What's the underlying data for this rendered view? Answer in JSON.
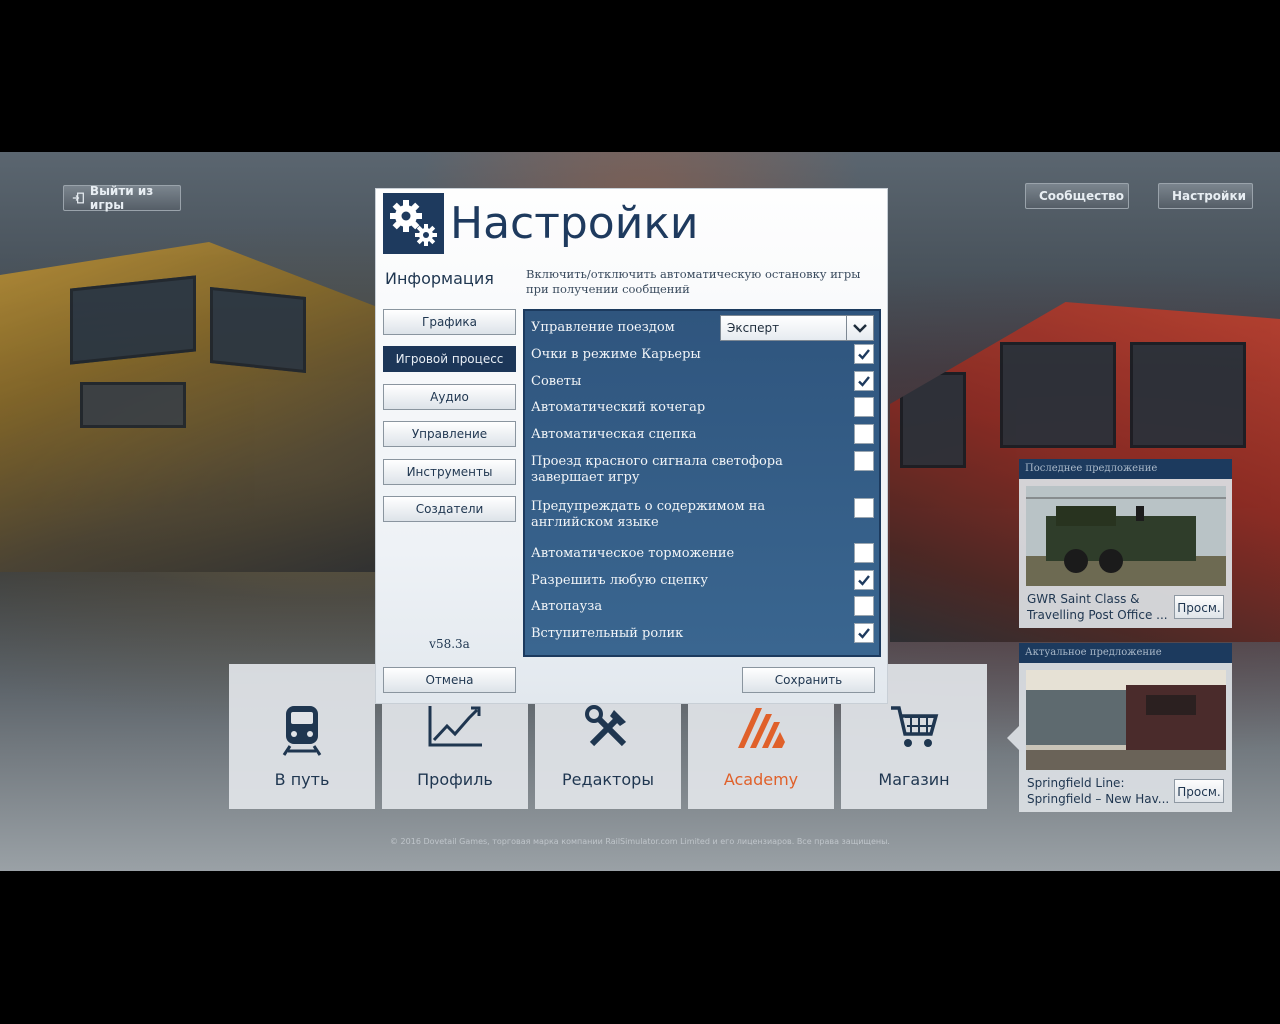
{
  "top_bar": {
    "exit_label": "Выйти из игры",
    "community_label": "Сообщество",
    "settings_label": "Настройки"
  },
  "dialog": {
    "title": "Настройки",
    "section": "Информация",
    "description": "Включить/отключить автоматическую остановку игры при получении сообщений",
    "nav": [
      "Графика",
      "Игровой процесс",
      "Аудио",
      "Управление",
      "Инструменты",
      "Создатели"
    ],
    "active_nav": "Игровой процесс",
    "version": "v58.3a",
    "train_control": {
      "label": "Управление поездом",
      "value": "Эксперт"
    },
    "options": [
      {
        "label": "Очки в режиме Карьеры",
        "checked": true
      },
      {
        "label": "Советы",
        "checked": true
      },
      {
        "label": "Автоматический кочегар",
        "checked": false
      },
      {
        "label": "Автоматическая сцепка",
        "checked": false
      },
      {
        "label": "Проезд красного сигнала светофора завершает игру",
        "checked": false
      },
      {
        "label": "Предупреждать о содержимом на английском языке",
        "checked": false
      },
      {
        "label": "Автоматическое торможение",
        "checked": false
      },
      {
        "label": "Разрешить любую сцепку",
        "checked": true
      },
      {
        "label": "Автопауза",
        "checked": false
      },
      {
        "label": "Вступительный ролик",
        "checked": true
      }
    ],
    "cancel_label": "Отмена",
    "save_label": "Сохранить"
  },
  "tiles": [
    {
      "label": "В путь",
      "icon": "train-icon"
    },
    {
      "label": "Профиль",
      "icon": "chart-icon"
    },
    {
      "label": "Редакторы",
      "icon": "tools-icon"
    },
    {
      "label": "Academy",
      "icon": "academy-icon"
    },
    {
      "label": "Магазин",
      "icon": "cart-icon"
    }
  ],
  "offers": {
    "latest": {
      "header": "Последнее предложение",
      "title_line1": "GWR Saint Class &",
      "title_line2": "Travelling Post Office ...",
      "button": "Просм."
    },
    "current": {
      "header": "Актуальное предложение",
      "title_line1": "Springfield Line:",
      "title_line2": "Springfield – New Hav...",
      "button": "Просм."
    }
  },
  "copyright": "© 2016 Dovetail Games, торговая марка компании RailSimulator.com Limited и его лицензиаров. Все права защищены.",
  "colors": {
    "navy": "#1e3a5e",
    "panel": "#2f557e",
    "academy": "#e0602a"
  }
}
